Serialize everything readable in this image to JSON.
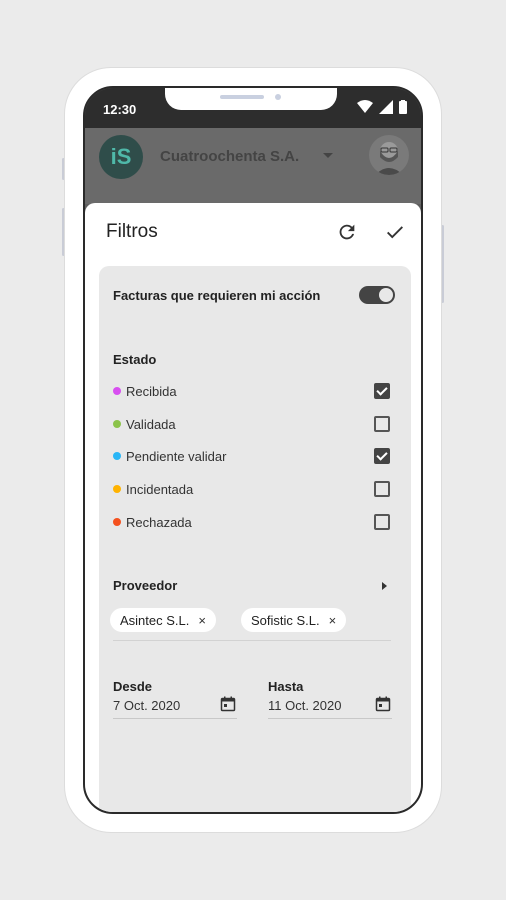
{
  "status_bar": {
    "time": "12:30"
  },
  "app_bar": {
    "logo_text": "iS",
    "company": "Cuatroochenta S.A."
  },
  "sheet": {
    "title": "Filtros"
  },
  "filters": {
    "my_action_label": "Facturas que requieren mi acción",
    "my_action_enabled": true,
    "status_title": "Estado",
    "states": [
      {
        "label": "Recibida",
        "color": "#d84ff0",
        "checked": true
      },
      {
        "label": "Validada",
        "color": "#8bc34a",
        "checked": false
      },
      {
        "label": "Pendiente validar",
        "color": "#29b6f6",
        "checked": true
      },
      {
        "label": "Incidentada",
        "color": "#ffb300",
        "checked": false
      },
      {
        "label": "Rechazada",
        "color": "#f4511e",
        "checked": false
      }
    ],
    "provider_title": "Proveedor",
    "providers": [
      "Asintec S.L.",
      "Sofistic S.L."
    ],
    "chip_remove": "×",
    "from_label": "Desde",
    "from_value": "7 Oct. 2020",
    "to_label": "Hasta",
    "to_value": "11 Oct. 2020"
  }
}
